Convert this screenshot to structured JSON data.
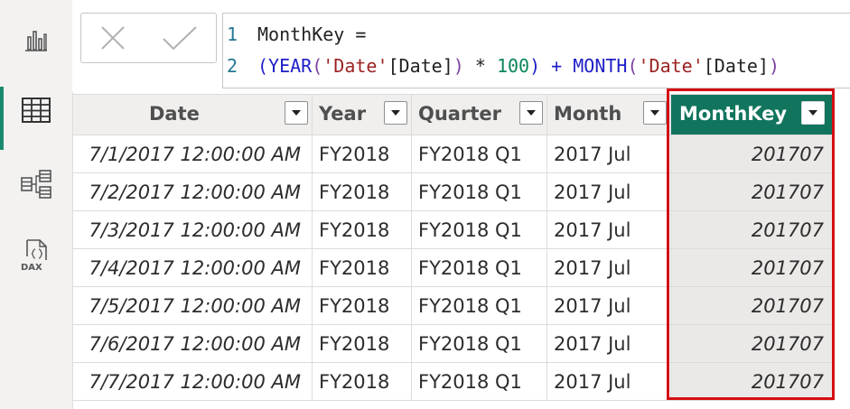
{
  "rail": {
    "items": [
      {
        "name": "report-view-icon"
      },
      {
        "name": "data-view-icon",
        "active": true
      },
      {
        "name": "model-view-icon"
      },
      {
        "name": "dax-query-view-icon",
        "label": "DAX"
      }
    ]
  },
  "formula": {
    "lines": [
      {
        "number": "1",
        "text": "MonthKey ="
      },
      {
        "number": "2",
        "parts": [
          "(",
          "YEAR",
          "(",
          "'Date'",
          "[Date]",
          ")",
          " * ",
          "100",
          ") + ",
          "MONTH",
          "(",
          "'Date'",
          "[Date]",
          ")"
        ]
      }
    ]
  },
  "table": {
    "columns": [
      "Date",
      "Year",
      "Quarter",
      "Month",
      "MonthKey"
    ],
    "selected_column": "MonthKey",
    "rows": [
      [
        "7/1/2017 12:00:00 AM",
        "FY2018",
        "FY2018 Q1",
        "2017 Jul",
        "201707"
      ],
      [
        "7/2/2017 12:00:00 AM",
        "FY2018",
        "FY2018 Q1",
        "2017 Jul",
        "201707"
      ],
      [
        "7/3/2017 12:00:00 AM",
        "FY2018",
        "FY2018 Q1",
        "2017 Jul",
        "201707"
      ],
      [
        "7/4/2017 12:00:00 AM",
        "FY2018",
        "FY2018 Q1",
        "2017 Jul",
        "201707"
      ],
      [
        "7/5/2017 12:00:00 AM",
        "FY2018",
        "FY2018 Q1",
        "2017 Jul",
        "201707"
      ],
      [
        "7/6/2017 12:00:00 AM",
        "FY2018",
        "FY2018 Q1",
        "2017 Jul",
        "201707"
      ],
      [
        "7/7/2017 12:00:00 AM",
        "FY2018",
        "FY2018 Q1",
        "2017 Jul",
        "201707"
      ]
    ]
  },
  "colors": {
    "accent": "#1a8a6e",
    "selected_header": "#11755d",
    "highlight_box": "#d40f14"
  }
}
